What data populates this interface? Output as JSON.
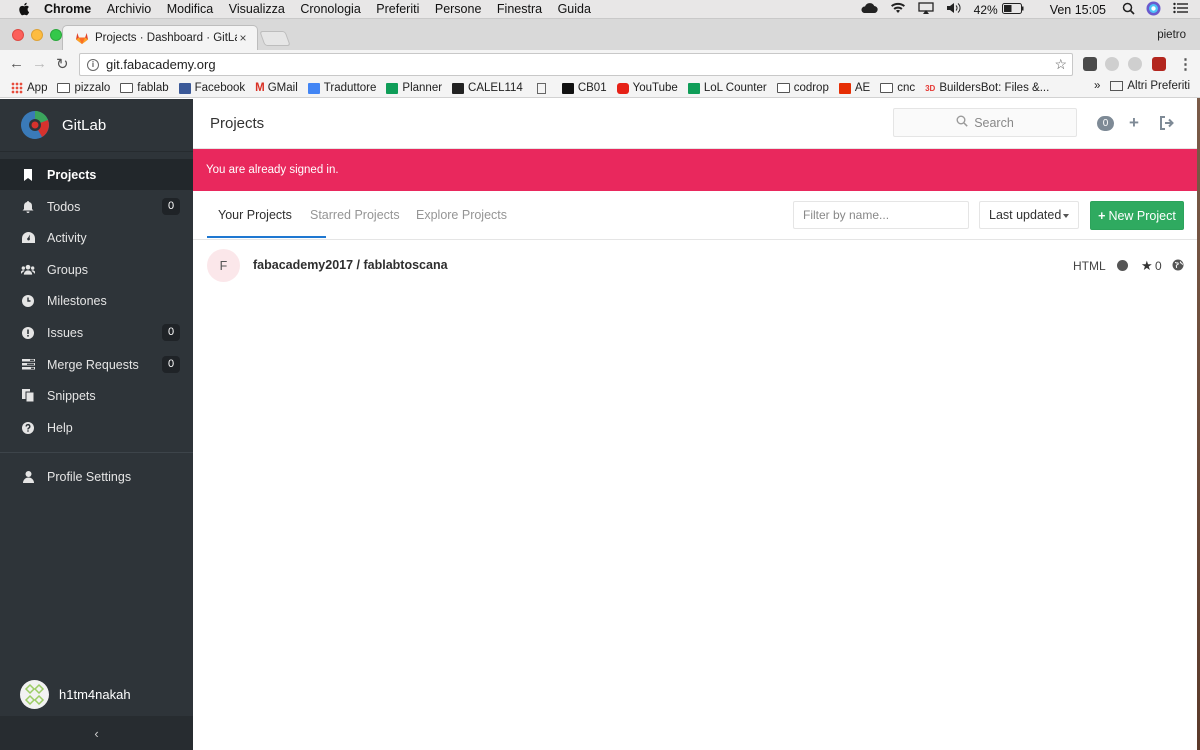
{
  "menubar": {
    "items": [
      "Chrome",
      "Archivio",
      "Modifica",
      "Visualizza",
      "Cronologia",
      "Preferiti",
      "Persone",
      "Finestra",
      "Guida"
    ],
    "battery": "42%",
    "clock": "Ven 15:05"
  },
  "browser": {
    "tab_title": "Projects · Dashboard · GitLab",
    "tab_close": "×",
    "profile": "pietro",
    "url": "git.fabacademy.org",
    "bookmarks": [
      "App",
      "pizzalo",
      "fablab",
      "Facebook",
      "GMail",
      "Traduttore",
      "Planner",
      "CALEL114",
      "",
      "CB01",
      "YouTube",
      "LoL Counter",
      "codrop",
      "AE",
      "cnc",
      "BuildersBot: Files &..."
    ],
    "bookmarks_more": "»",
    "other_bookmarks": "Altri Preferiti"
  },
  "sidebar": {
    "brand": "GitLab",
    "items": [
      {
        "label": "Projects",
        "count": ""
      },
      {
        "label": "Todos",
        "count": "0"
      },
      {
        "label": "Activity",
        "count": ""
      },
      {
        "label": "Groups",
        "count": ""
      },
      {
        "label": "Milestones",
        "count": ""
      },
      {
        "label": "Issues",
        "count": "0"
      },
      {
        "label": "Merge Requests",
        "count": "0"
      },
      {
        "label": "Snippets",
        "count": ""
      },
      {
        "label": "Help",
        "count": ""
      }
    ],
    "profile_settings": "Profile Settings",
    "username": "h1tm4nakah",
    "collapse": "‹"
  },
  "header": {
    "title": "Projects",
    "search_placeholder": "Search",
    "todos_count": "0"
  },
  "flash": "You are already signed in.",
  "tabs": [
    "Your Projects",
    "Starred Projects",
    "Explore Projects"
  ],
  "filter_placeholder": "Filter by name...",
  "sort_label": "Last updated",
  "new_project": "New Project",
  "projects": [
    {
      "avatar_letter": "F",
      "name": "fabacademy2017 / fablabtoscana",
      "language": "HTML",
      "stars": "0"
    }
  ],
  "colors": {
    "sidebar": "#2e3439",
    "flash": "#e9285d",
    "new_project": "#2faa60",
    "active_tab": "#1f78d1"
  }
}
